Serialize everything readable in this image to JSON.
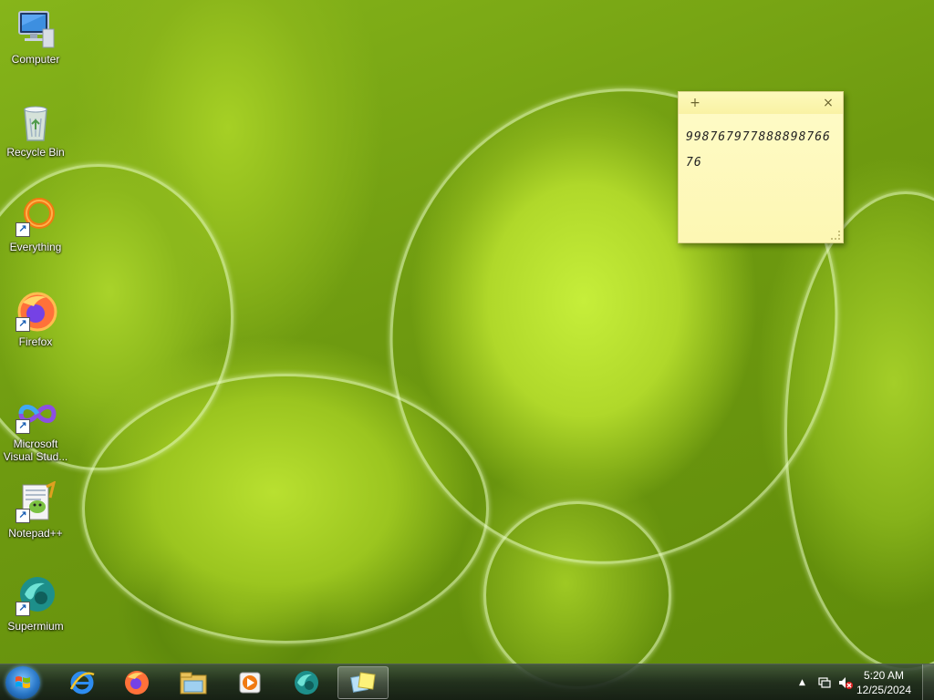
{
  "desktop": {
    "icons": [
      {
        "label": "Computer",
        "icon": "computer-icon"
      },
      {
        "label": "Recycle Bin",
        "icon": "recycle-bin-icon"
      },
      {
        "label": "Everything",
        "icon": "everything-icon"
      },
      {
        "label": "Firefox",
        "icon": "firefox-icon"
      },
      {
        "label": "Microsoft Visual Stud...",
        "icon": "visual-studio-icon"
      },
      {
        "label": "Notepad++",
        "icon": "notepadpp-icon"
      },
      {
        "label": "Supermium",
        "icon": "supermium-icon"
      }
    ]
  },
  "sticky_note": {
    "add_glyph": "+",
    "close_glyph": "×",
    "text": "99876797788889876676",
    "color": "#fdf7b3"
  },
  "taskbar": {
    "items": [
      {
        "icon": "internet-explorer-icon"
      },
      {
        "icon": "firefox-icon"
      },
      {
        "icon": "file-explorer-icon"
      },
      {
        "icon": "media-player-icon"
      },
      {
        "icon": "supermium-icon"
      },
      {
        "icon": "sticky-notes-icon",
        "active": true
      }
    ],
    "tray": {
      "overflow_glyph": "▲",
      "icons": [
        "network-icon",
        "volume-muted-icon"
      ]
    },
    "clock": {
      "time": "5:20 AM",
      "date": "12/25/2024"
    }
  }
}
